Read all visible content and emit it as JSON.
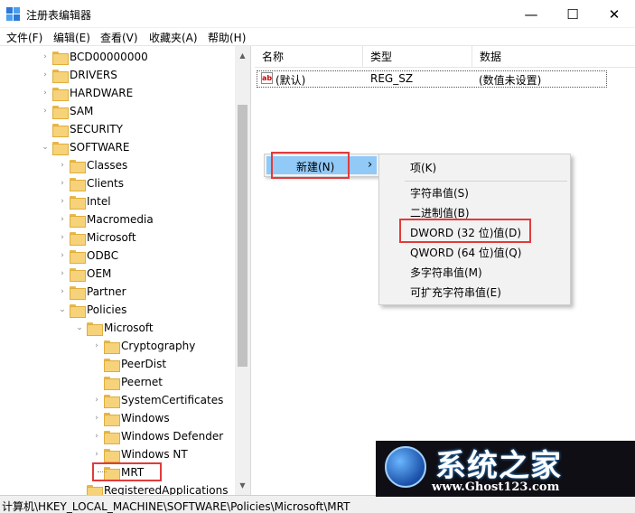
{
  "window": {
    "title": "注册表编辑器",
    "minimize": "—",
    "maximize": "☐",
    "close": "✕"
  },
  "menubar": [
    "文件(F)",
    "编辑(E)",
    "查看(V)",
    "收藏夹(A)",
    "帮助(H)"
  ],
  "tree": {
    "nodes": [
      {
        "label": "BCD00000000",
        "expander": "›"
      },
      {
        "label": "DRIVERS",
        "expander": "›"
      },
      {
        "label": "HARDWARE",
        "expander": "›"
      },
      {
        "label": "SAM",
        "expander": "›"
      },
      {
        "label": "SECURITY",
        "expander": ""
      },
      {
        "label": "SOFTWARE",
        "expander": "⌄"
      },
      {
        "label": "Classes",
        "expander": "›"
      },
      {
        "label": "Clients",
        "expander": "›"
      },
      {
        "label": "Intel",
        "expander": "›"
      },
      {
        "label": "Macromedia",
        "expander": "›"
      },
      {
        "label": "Microsoft",
        "expander": "›"
      },
      {
        "label": "ODBC",
        "expander": "›"
      },
      {
        "label": "OEM",
        "expander": "›"
      },
      {
        "label": "Partner",
        "expander": "›"
      },
      {
        "label": "Policies",
        "expander": "⌄"
      },
      {
        "label": "Microsoft",
        "expander": "⌄"
      },
      {
        "label": "Cryptography",
        "expander": "›"
      },
      {
        "label": "PeerDist",
        "expander": ""
      },
      {
        "label": "Peernet",
        "expander": ""
      },
      {
        "label": "SystemCertificates",
        "expander": "›"
      },
      {
        "label": "Windows",
        "expander": "›"
      },
      {
        "label": "Windows Defender",
        "expander": "›"
      },
      {
        "label": "Windows NT",
        "expander": "›"
      },
      {
        "label": "MRT",
        "expander": ""
      },
      {
        "label": "RegisteredApplications",
        "expander": ""
      }
    ]
  },
  "list": {
    "columns": [
      "名称",
      "类型",
      "数据"
    ],
    "rows": [
      {
        "name": "(默认)",
        "type": "REG_SZ",
        "data": "(数值未设置)",
        "icon": "ab"
      }
    ]
  },
  "context_menu": {
    "new_label": "新建(N)",
    "submenu_arrow": "›",
    "submenu": [
      "项(K)",
      "字符串值(S)",
      "二进制值(B)",
      "DWORD (32 位)值(D)",
      "QWORD (64 位)值(Q)",
      "多字符串值(M)",
      "可扩充字符串值(E)"
    ]
  },
  "status": {
    "path": "计算机\\HKEY_LOCAL_MACHINE\\SOFTWARE\\Policies\\Microsoft\\MRT"
  },
  "watermark": {
    "title": "系统之家",
    "url": "www.Ghost123.com"
  },
  "colors": {
    "highlight": "#91c9f7",
    "redbox": "#e23b3b",
    "folder": "#f6d27a"
  }
}
